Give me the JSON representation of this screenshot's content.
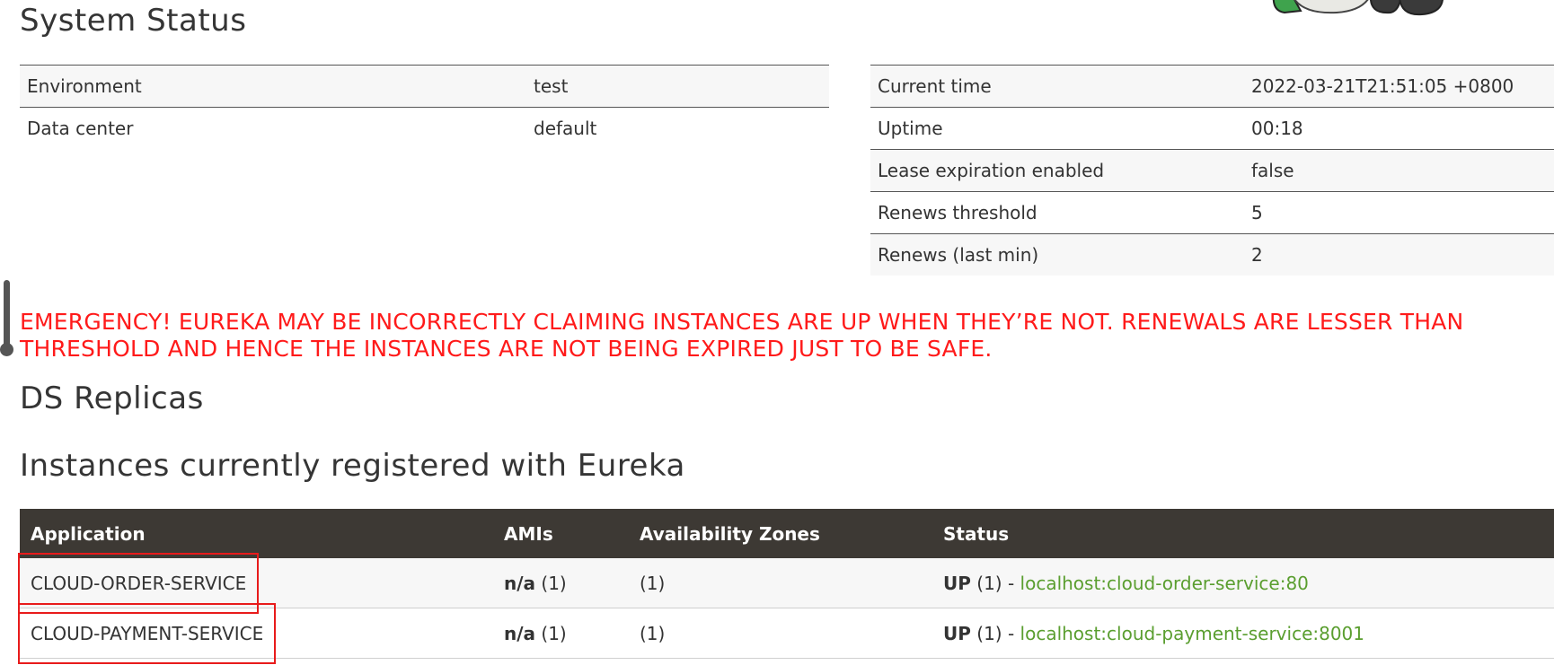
{
  "system_status": {
    "title": "System Status",
    "left_table": [
      {
        "key": "Environment",
        "value": "test"
      },
      {
        "key": "Data center",
        "value": "default"
      }
    ],
    "right_table": [
      {
        "key": "Current time",
        "value": "2022-03-21T21:51:05 +0800"
      },
      {
        "key": "Uptime",
        "value": "00:18"
      },
      {
        "key": "Lease expiration enabled",
        "value": "false"
      },
      {
        "key": "Renews threshold",
        "value": "5"
      },
      {
        "key": "Renews (last min)",
        "value": "2"
      }
    ]
  },
  "emergency": {
    "line1": "EMERGENCY! EUREKA MAY BE INCORRECTLY CLAIMING INSTANCES ARE UP WHEN THEY’RE NOT. RENEWALS ARE LESSER THAN",
    "line2": "THRESHOLD AND HENCE THE INSTANCES ARE NOT BEING EXPIRED JUST TO BE SAFE.",
    "color": "#ff1a1a"
  },
  "ds_replicas": {
    "title": "DS Replicas"
  },
  "instances": {
    "title": "Instances currently registered with Eureka",
    "columns": [
      "Application",
      "AMIs",
      "Availability Zones",
      "Status"
    ],
    "rows": [
      {
        "application": "CLOUD-ORDER-SERVICE",
        "amis_label": "n/a",
        "amis_count": "(1)",
        "zones": "(1)",
        "status_label": "UP",
        "status_count": "(1) -",
        "instance_link": "localhost:cloud-order-service:80"
      },
      {
        "application": "CLOUD-PAYMENT-SERVICE",
        "amis_label": "n/a",
        "amis_count": "(1)",
        "zones": "(1)",
        "status_label": "UP",
        "status_count": "(1) -",
        "instance_link": "localhost:cloud-payment-service:8001"
      }
    ]
  },
  "colors": {
    "header_bg": "#3d3934",
    "link": "#5a9e2f",
    "highlight_box": "#e81b1b"
  }
}
